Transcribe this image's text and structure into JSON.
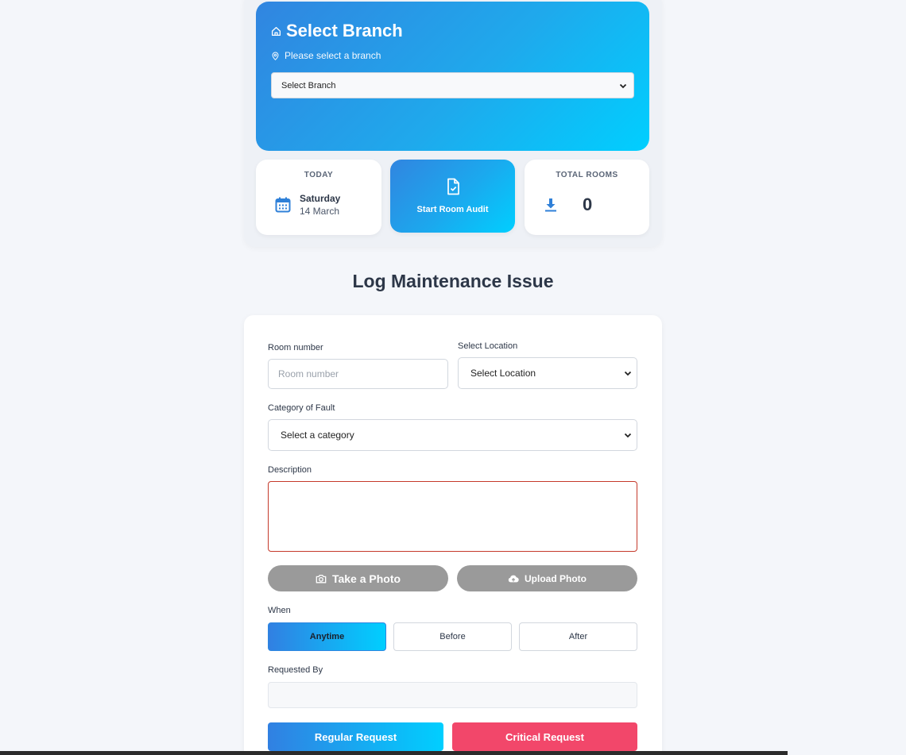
{
  "branch": {
    "title": "Select Branch",
    "subtitle": "Please select a branch",
    "select_value": "Select Branch",
    "icon": "home-icon",
    "subtitle_icon": "map-pin-icon"
  },
  "stats": {
    "today": {
      "label": "TODAY",
      "day": "Saturday",
      "date": "14 March",
      "icon": "calendar-icon"
    },
    "audit": {
      "label": "Start Room Audit",
      "icon": "file-check-icon"
    },
    "rooms": {
      "label": "TOTAL ROOMS",
      "count": "0",
      "icon": "download-icon"
    }
  },
  "form": {
    "title": "Log Maintenance Issue",
    "room_number": {
      "label": "Room number",
      "placeholder": "Room number",
      "value": ""
    },
    "location": {
      "label": "Select Location",
      "value": "Select Location"
    },
    "category": {
      "label": "Category of Fault",
      "value": "Select a category"
    },
    "description": {
      "label": "Description",
      "value": ""
    },
    "take_photo": {
      "label": "Take a Photo",
      "icon": "camera-icon"
    },
    "upload_photo": {
      "label": "Upload Photo",
      "icon": "cloud-upload-icon"
    },
    "when": {
      "label": "When",
      "options": [
        "Anytime",
        "Before",
        "After"
      ],
      "selected": "Anytime"
    },
    "requested_by": {
      "label": "Requested By",
      "value": ""
    },
    "regular_button": "Regular Request",
    "critical_button": "Critical Request"
  },
  "colors": {
    "gradient_start": "#3180e2",
    "gradient_end": "#00cfff",
    "critical": "#f2476a",
    "photo_button": "#9a9a9a",
    "description_border": "#c53a2b"
  }
}
